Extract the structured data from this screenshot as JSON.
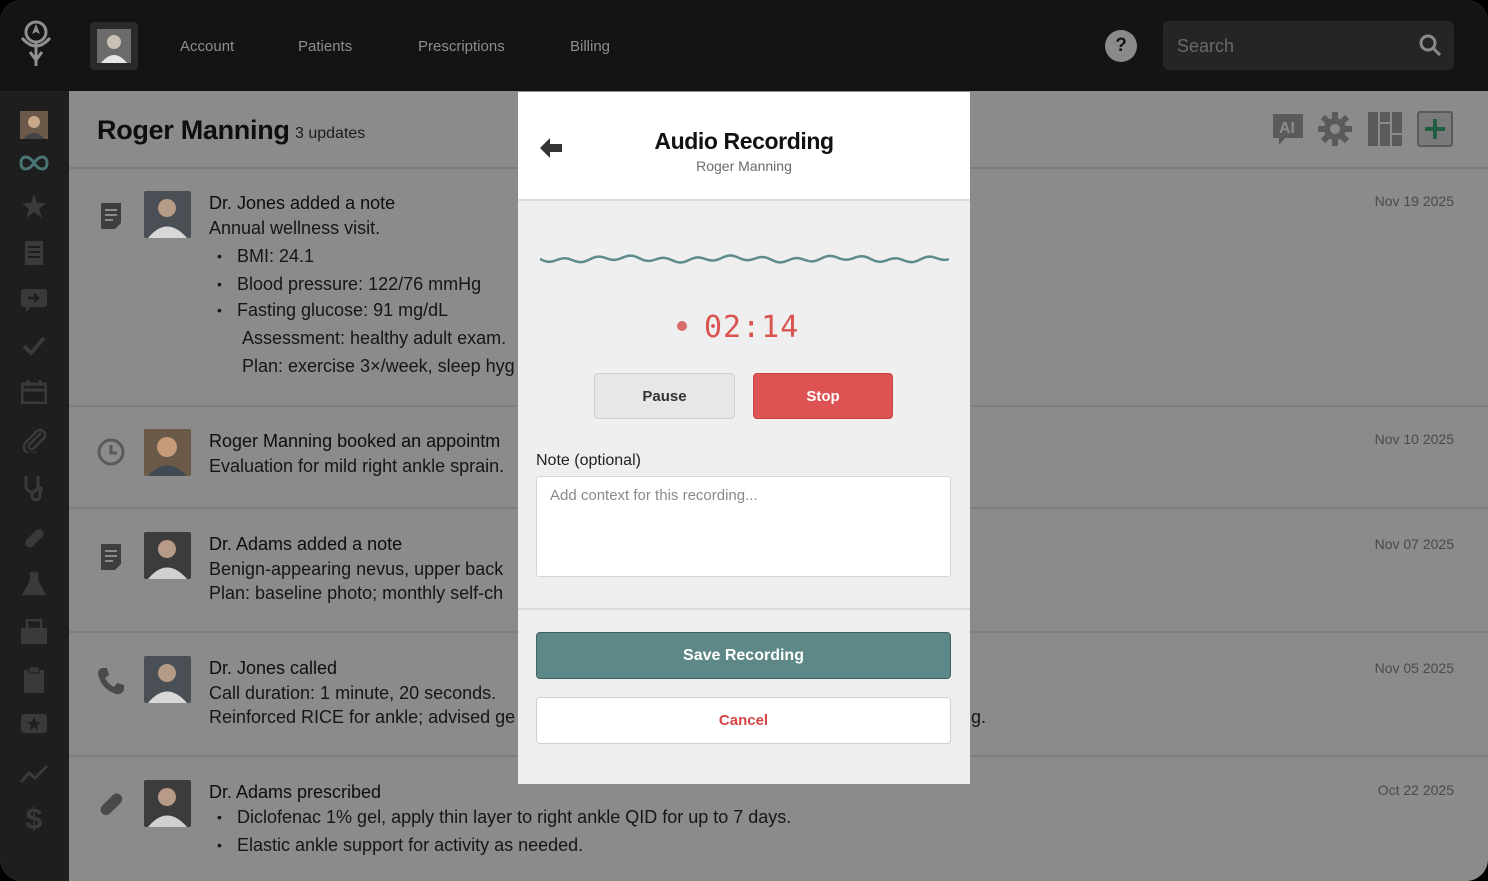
{
  "nav": {
    "items": [
      "Account",
      "Patients",
      "Prescriptions",
      "Billing"
    ],
    "help_label": "?",
    "search_placeholder": "Search"
  },
  "header": {
    "patient_name": "Roger Manning",
    "updates": "3 updates"
  },
  "feed": [
    {
      "icon": "note-icon",
      "title": "Dr. Jones added a note",
      "lines": [
        "Annual wellness visit."
      ],
      "bullets": [
        "BMI: 24.1",
        "Blood pressure: 122/76 mmHg",
        "Fasting glucose: 91 mg/dL"
      ],
      "indented": [
        "Assessment: healthy adult exam.",
        "Plan: exercise 3×/week, sleep hyg"
      ],
      "date": "Nov 19 2025"
    },
    {
      "icon": "clock-icon",
      "title": "Roger Manning booked an appointm",
      "lines": [
        "Evaluation for mild right ankle sprain."
      ],
      "date": "Nov 10 2025"
    },
    {
      "icon": "note-icon",
      "title": "Dr. Adams added a note",
      "lines": [
        "Benign-appearing nevus, upper back",
        "Plan: baseline photo; monthly self-ch"
      ],
      "date": "Nov 07 2025"
    },
    {
      "icon": "phone-icon",
      "title": "Dr. Jones called",
      "lines": [
        "Call duration: 1 minute, 20 seconds.",
        "Reinforced RICE for ankle; advised ge"
      ],
      "tail": "g.",
      "date": "Nov 05 2025"
    },
    {
      "icon": "pill-icon",
      "title": "Dr. Adams prescribed",
      "bullets": [
        "Diclofenac 1% gel, apply thin layer to right ankle QID for up to 7 days.",
        "Elastic ankle support for activity as needed."
      ],
      "date": "Oct 22 2025"
    }
  ],
  "modal": {
    "title": "Audio Recording",
    "subtitle": "Roger Manning",
    "timer": "02:14",
    "pause_label": "Pause",
    "stop_label": "Stop",
    "note_label": "Note (optional)",
    "note_placeholder": "Add context for this recording...",
    "save_label": "Save Recording",
    "cancel_label": "Cancel"
  },
  "colors": {
    "accent": "#5e8787",
    "stop": "#dd5252",
    "timer": "#d9534f",
    "wave": "#5e8c8c"
  }
}
